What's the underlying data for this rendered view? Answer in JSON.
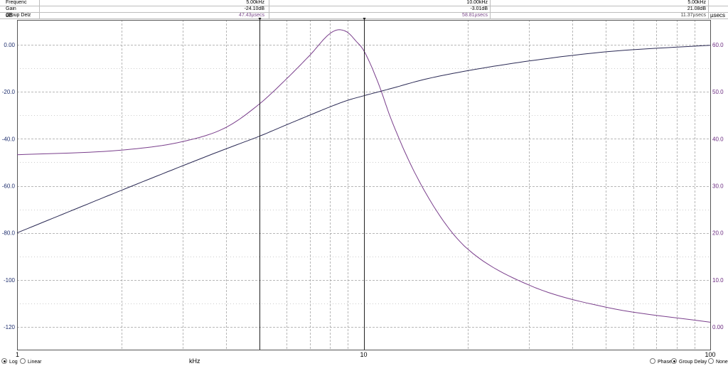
{
  "readout": {
    "rows": [
      {
        "label": "Frequenc",
        "v1": "5.00kHz",
        "v2": "10.00kHz",
        "v3": "5.00kHz"
      },
      {
        "label": "Gain",
        "v1": "-24.10dB",
        "v2": "-3.01dB",
        "v3": "21.08dB"
      },
      {
        "label": "Group Delz",
        "v1": "47.43µsecs",
        "v2": "58.81µsecs",
        "v3": "11.37µsecs"
      }
    ]
  },
  "axes": {
    "left_unit": "dB",
    "right_unit": "µsecs",
    "x_unit": "kHz"
  },
  "controls": {
    "x_scale": [
      {
        "label": "Log",
        "selected": true
      },
      {
        "label": "Linear",
        "selected": false
      }
    ],
    "trace": [
      {
        "label": "Phase",
        "selected": false
      },
      {
        "label": "Group Delay",
        "selected": true
      },
      {
        "label": "None",
        "selected": false
      }
    ]
  },
  "colors": {
    "gain": "#2b2a55",
    "group_delay": "#7a3f8c",
    "grid": "#9a9a9a",
    "left_ticks": "#1f2f6e",
    "right_ticks": "#6b2a80"
  },
  "chart_data": {
    "type": "line",
    "x_scale": "log",
    "xlim": [
      1,
      100
    ],
    "x_ticks": [
      "1",
      "10",
      "100"
    ],
    "y_left": {
      "label": "dB",
      "lim": [
        -120,
        0
      ],
      "ticks": [
        "0.00",
        "-20.0",
        "-40.0",
        "-60.0",
        "-80.0",
        "-100",
        "-120"
      ]
    },
    "y_right": {
      "label": "µsecs",
      "lim": [
        0,
        60
      ],
      "ticks": [
        "60.0",
        "50.0",
        "40.0",
        "30.0",
        "20.0",
        "10.0",
        "0.00"
      ]
    },
    "cursors_kHz": [
      5,
      10
    ],
    "grid": true,
    "series": [
      {
        "axis": "left",
        "color": "#2b2a55",
        "x": [
          1,
          1.5,
          2,
          3,
          4,
          5,
          6,
          7,
          8,
          9,
          10,
          12,
          15,
          20,
          30,
          50,
          100
        ],
        "y": [
          -80,
          -69.4,
          -61.9,
          -51.5,
          -44.3,
          -38.9,
          -34.0,
          -29.9,
          -26.4,
          -23.6,
          -21.7,
          -18.6,
          -14.7,
          -11.0,
          -6.9,
          -3.0,
          -0.2
        ]
      },
      {
        "axis": "right",
        "color": "#7a3f8c",
        "x": [
          1,
          2,
          3,
          4,
          5,
          6,
          7,
          8,
          8.5,
          9,
          9.5,
          10,
          11,
          12,
          14,
          17,
          20,
          30,
          50,
          100
        ],
        "y": [
          36.6,
          37.6,
          39.4,
          42.4,
          47.4,
          52.8,
          57.8,
          62.4,
          63.2,
          62.6,
          60.8,
          58.8,
          52.0,
          44.2,
          33.0,
          22.5,
          16.5,
          8.9,
          4.2,
          1.0
        ]
      }
    ]
  }
}
